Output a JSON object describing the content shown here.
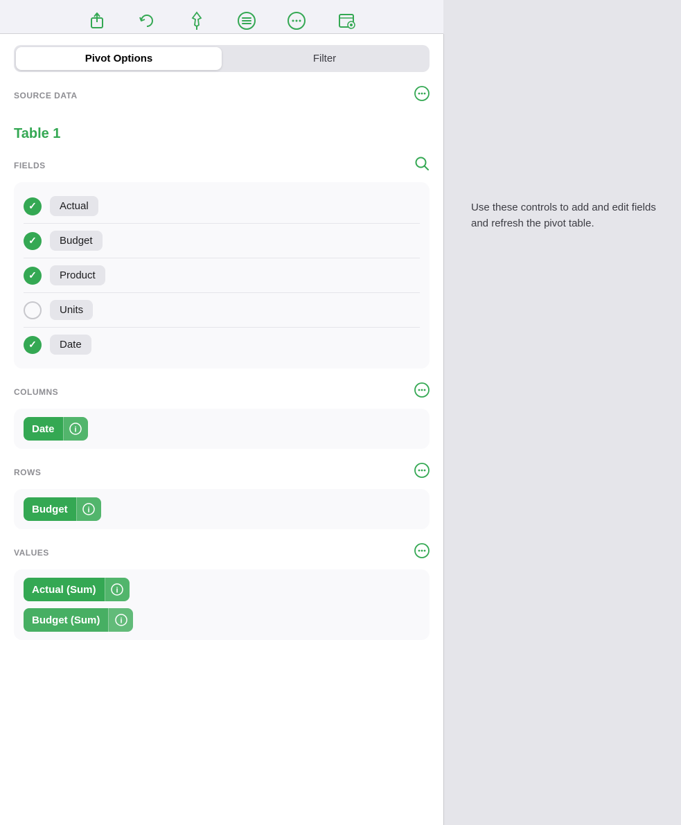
{
  "toolbar": {
    "icons": [
      {
        "name": "share-icon",
        "symbol": "↑",
        "active": false
      },
      {
        "name": "undo-icon",
        "symbol": "↩",
        "active": false
      },
      {
        "name": "pin-icon",
        "symbol": "📌",
        "active": false
      },
      {
        "name": "menu-icon",
        "symbol": "≡",
        "active": true
      },
      {
        "name": "more-icon",
        "symbol": "⋯",
        "active": false
      },
      {
        "name": "view-icon",
        "symbol": "👁",
        "active": false
      }
    ]
  },
  "tabs": [
    {
      "label": "Pivot Options",
      "active": true
    },
    {
      "label": "Filter",
      "active": false
    }
  ],
  "source_data": {
    "section_label": "SOURCE DATA",
    "table_name": "Table 1"
  },
  "fields": {
    "section_label": "FIELDS",
    "items": [
      {
        "label": "Actual",
        "checked": true
      },
      {
        "label": "Budget",
        "checked": true
      },
      {
        "label": "Product",
        "checked": true
      },
      {
        "label": "Units",
        "checked": false
      },
      {
        "label": "Date",
        "checked": true
      }
    ]
  },
  "columns": {
    "section_label": "COLUMNS",
    "items": [
      {
        "label": "Date"
      }
    ]
  },
  "rows": {
    "section_label": "ROWS",
    "items": [
      {
        "label": "Budget"
      }
    ]
  },
  "values": {
    "section_label": "VALUES",
    "items": [
      {
        "label": "Actual (Sum)"
      },
      {
        "label": "Budget (Sum)"
      }
    ]
  },
  "hint": {
    "text": "Use these controls to add and edit fields and refresh the pivot table."
  }
}
